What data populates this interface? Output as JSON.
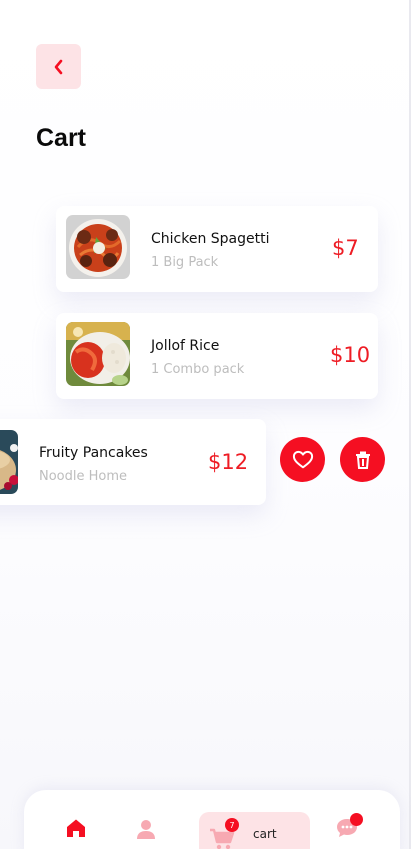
{
  "header": {
    "title": "Cart"
  },
  "cart": {
    "items": [
      {
        "name": "Chicken Spagetti",
        "subtitle": "1 Big Pack",
        "price": "$7"
      },
      {
        "name": "Jollof Rice",
        "subtitle": "1 Combo pack",
        "price": "$10"
      },
      {
        "name": "Fruity Pancakes",
        "subtitle": "Noodle Home",
        "price": "$12"
      }
    ]
  },
  "bottom_nav": {
    "cart_label": "cart",
    "cart_badge": "7"
  },
  "colors": {
    "accent": "#f50f22",
    "accent_light": "#fde3e6",
    "price": "#ee1c24",
    "muted_text": "#bdbdbd"
  },
  "icons": [
    "chevron-left-icon",
    "heart-icon",
    "trash-icon",
    "home-icon",
    "profile-icon",
    "cart-icon",
    "chat-icon"
  ]
}
